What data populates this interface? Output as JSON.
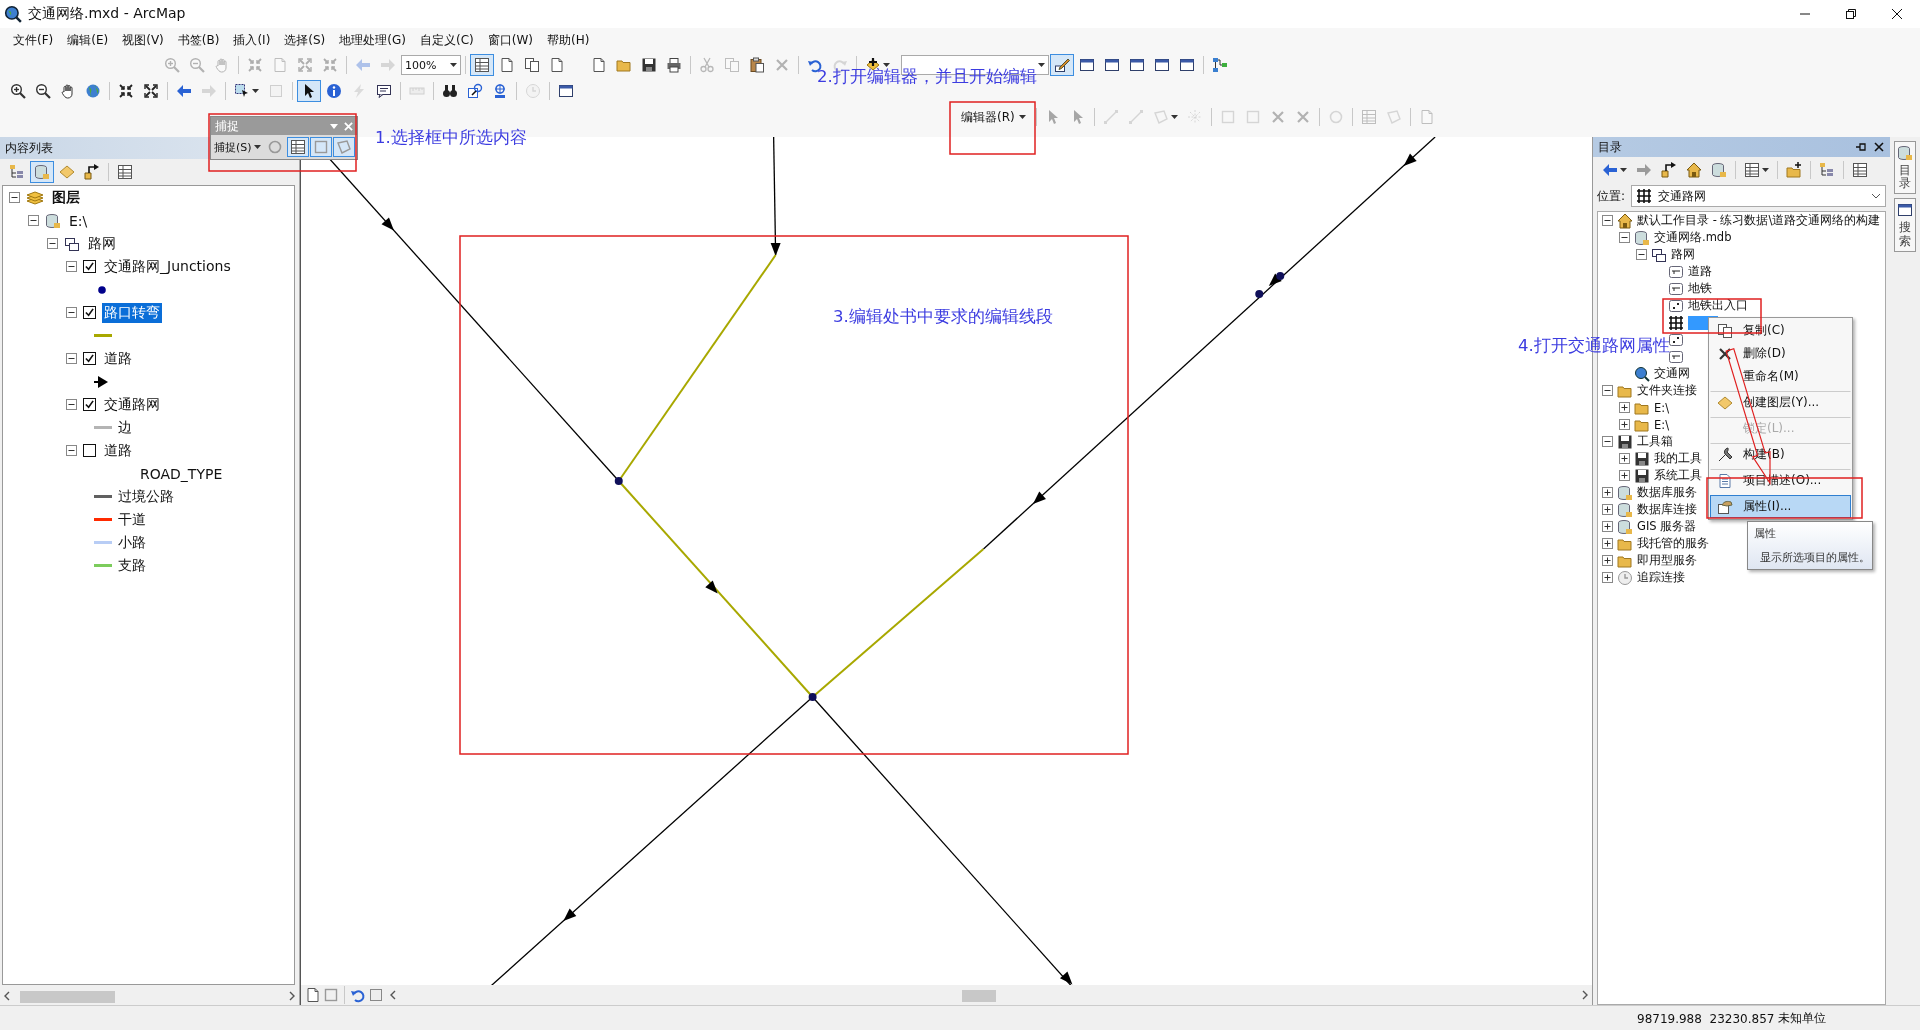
{
  "window": {
    "title": "交通网络.mxd - ArcMap"
  },
  "menu": [
    "文件(F)",
    "编辑(E)",
    "视图(V)",
    "书签(B)",
    "插入(I)",
    "选择(S)",
    "地理处理(G)",
    "自定义(C)",
    "窗口(W)",
    "帮助(H)"
  ],
  "toolbars": {
    "layout": {
      "before": [
        {
          "disabled": true,
          "pressed": false
        },
        {
          "disabled": true,
          "pressed": false
        },
        {
          "disabled": true,
          "pressed": false
        },
        {
          "disabled": true,
          "pressed": false
        },
        {
          "disabled": true,
          "pressed": false
        },
        {
          "disabled": true,
          "pressed": false
        },
        {
          "disabled": true,
          "pressed": false
        },
        {
          "disabled": true,
          "pressed": false
        },
        {
          "disabled": true,
          "pressed": false
        }
      ],
      "zoom": "100%",
      "after": [
        {
          "disabled": false,
          "pressed": true
        },
        {
          "disabled": false,
          "pressed": false
        },
        {
          "disabled": false,
          "pressed": false
        },
        {
          "disabled": false,
          "pressed": false
        }
      ]
    },
    "standard": {
      "buttons": [
        {
          "disabled": false,
          "pressed": false
        },
        {
          "disabled": false,
          "pressed": false
        },
        {
          "disabled": false,
          "pressed": false
        },
        {
          "disabled": false,
          "pressed": false
        },
        {
          "disabled": true,
          "pressed": false
        },
        {
          "disabled": true,
          "pressed": false
        },
        {
          "disabled": false,
          "pressed": false
        },
        {
          "disabled": true,
          "pressed": false
        },
        {
          "disabled": false,
          "pressed": false
        },
        {
          "disabled": true,
          "pressed": false
        },
        {
          "disabled": false,
          "pressed": false
        }
      ]
    },
    "windows": {
      "buttons": [
        {
          "disabled": false,
          "pressed": true
        },
        {
          "disabled": false,
          "pressed": false
        },
        {
          "disabled": false,
          "pressed": false
        },
        {
          "disabled": false,
          "pressed": false
        },
        {
          "disabled": false,
          "pressed": false
        },
        {
          "disabled": false,
          "pressed": false
        },
        {
          "disabled": false,
          "pressed": false
        }
      ]
    },
    "tools": {
      "buttons": [
        {
          "disabled": false,
          "pressed": false
        },
        {
          "disabled": false,
          "pressed": false
        },
        {
          "disabled": false,
          "pressed": false
        },
        {
          "disabled": false,
          "pressed": false
        },
        {
          "disabled": false,
          "pressed": false
        },
        {
          "disabled": false,
          "pressed": false
        },
        {
          "disabled": false,
          "pressed": false
        },
        {
          "disabled": true,
          "pressed": false
        },
        {
          "disabled": false,
          "pressed": false
        },
        {
          "disabled": true,
          "pressed": false
        },
        {
          "disabled": false,
          "pressed": true
        },
        {
          "disabled": false,
          "pressed": false
        },
        {
          "disabled": true,
          "pressed": false
        },
        {
          "disabled": false,
          "pressed": false
        },
        {
          "disabled": true,
          "pressed": false
        },
        {
          "disabled": false,
          "pressed": false
        },
        {
          "disabled": false,
          "pressed": false
        },
        {
          "disabled": false,
          "pressed": false
        },
        {
          "disabled": true,
          "pressed": false
        },
        {
          "disabled": false,
          "pressed": false
        }
      ]
    },
    "editor": {
      "menu": "编辑器(R)",
      "buttons": [
        {
          "disabled": true,
          "pressed": false
        },
        {
          "disabled": true,
          "pressed": false
        },
        {
          "disabled": true,
          "pressed": false
        },
        {
          "disabled": true,
          "pressed": false
        },
        {
          "disabled": true,
          "pressed": false
        },
        {
          "disabled": true,
          "pressed": false
        },
        {
          "disabled": true,
          "pressed": false
        },
        {
          "disabled": true,
          "pressed": false
        },
        {
          "disabled": true,
          "pressed": false
        },
        {
          "disabled": true,
          "pressed": false
        },
        {
          "disabled": true,
          "pressed": false
        },
        {
          "disabled": true,
          "pressed": false
        },
        {
          "disabled": true,
          "pressed": false
        },
        {
          "disabled": true,
          "pressed": false
        }
      ]
    }
  },
  "snapping": {
    "title": "捕捉",
    "menu": "捕捉(S)",
    "buttons": [
      {
        "pressed": false
      },
      {
        "pressed": true
      },
      {
        "pressed": true
      },
      {
        "pressed": true
      }
    ]
  },
  "contents": {
    "title": "内容列表",
    "view_buttons": [
      {
        "pressed": false
      },
      {
        "pressed": true
      },
      {
        "pressed": false
      },
      {
        "pressed": false
      },
      {
        "pressed": false
      }
    ],
    "tree": [
      {
        "label": "图层",
        "kind": "frame",
        "expanded": true,
        "children": [
          {
            "label": "E:\\",
            "kind": "database",
            "expanded": true,
            "children": [
              {
                "label": "路网",
                "kind": "group",
                "expanded": true,
                "children": [
                  {
                    "label": "交通路网_Junctions",
                    "kind": "layer",
                    "expanded": true,
                    "checked": true,
                    "selected": false,
                    "legend": [
                      {
                        "kind": "point",
                        "color": "#00008b"
                      }
                    ]
                  },
                  {
                    "label": "路口转弯",
                    "kind": "layer",
                    "expanded": true,
                    "checked": true,
                    "selected": true,
                    "legend": [
                      {
                        "kind": "line",
                        "color": "#a8a800"
                      }
                    ]
                  },
                  {
                    "label": "道路",
                    "kind": "layer",
                    "expanded": true,
                    "checked": true,
                    "selected": false,
                    "legend": [
                      {
                        "kind": "arrow",
                        "color": "#000000"
                      }
                    ]
                  },
                  {
                    "label": "交通路网",
                    "kind": "layer",
                    "expanded": true,
                    "checked": true,
                    "selected": false,
                    "legend": [
                      {
                        "kind": "line",
                        "color": "#b4b4b4",
                        "label": "边"
                      }
                    ]
                  },
                  {
                    "label": "道路",
                    "kind": "layer",
                    "expanded": true,
                    "checked": false,
                    "selected": false,
                    "legend": [
                      {
                        "kind": "heading",
                        "label": "ROAD_TYPE"
                      },
                      {
                        "kind": "line",
                        "color": "#606060",
                        "label": "过境公路"
                      },
                      {
                        "kind": "line",
                        "color": "#ff2a00",
                        "label": "干道"
                      },
                      {
                        "kind": "line",
                        "color": "#b8cdf5",
                        "label": "小路"
                      },
                      {
                        "kind": "line",
                        "color": "#7ccc5c",
                        "label": "支路"
                      }
                    ]
                  }
                ]
              }
            ]
          }
        ]
      }
    ]
  },
  "catalog": {
    "title": "目录",
    "location_label": "位置:",
    "location": "交通路网",
    "tree": [
      {
        "label": "默认工作目录 - 练习数据\\道路交通网络的构建",
        "kind": "home-folder",
        "expanded": true,
        "children": [
          {
            "label": "交通网络.mdb",
            "kind": "database",
            "expanded": true,
            "children": [
              {
                "label": "路网",
                "kind": "dataset",
                "expanded": true,
                "children": [
                  {
                    "label": "道路",
                    "kind": "line-class",
                    "selected": false
                  },
                  {
                    "label": "地铁",
                    "kind": "line-class",
                    "selected": false
                  },
                  {
                    "label": "地铁出入口",
                    "kind": "point-class",
                    "selected": false
                  },
                  {
                    "kind": "network",
                    "selected": true
                  },
                  {
                    "kind": "point-class",
                    "selected": false
                  },
                  {
                    "kind": "line-class",
                    "selected": false
                  }
                ]
              }
            ]
          },
          {
            "label": "交通网",
            "kind": "locator"
          }
        ]
      },
      {
        "label": "文件夹连接",
        "kind": "folder",
        "expanded": true,
        "children": [
          {
            "label": "E:\\",
            "kind": "folder",
            "expanded": false
          },
          {
            "label": "E:\\",
            "kind": "folder",
            "expanded": false
          }
        ]
      },
      {
        "label": "工具箱",
        "kind": "toolbox",
        "expanded": true,
        "children": [
          {
            "label": "我的工具",
            "kind": "toolbox",
            "expanded": false
          },
          {
            "label": "系统工具",
            "kind": "toolbox",
            "expanded": false
          }
        ]
      },
      {
        "label": "数据库服务",
        "kind": "server",
        "expanded": false
      },
      {
        "label": "数据库连接",
        "kind": "server",
        "expanded": false
      },
      {
        "label": "GIS 服务器",
        "kind": "server",
        "expanded": false
      },
      {
        "label": "我托管的服务",
        "kind": "cloud",
        "expanded": false
      },
      {
        "label": "即用型服务",
        "kind": "cloud",
        "expanded": false
      },
      {
        "label": "追踪连接",
        "kind": "tracking",
        "expanded": false
      }
    ]
  },
  "context_menu": {
    "items": [
      {
        "label": "复制(C)",
        "kind": "copy",
        "disabled": false,
        "selected": false,
        "divider_above": false
      },
      {
        "label": "删除(D)",
        "kind": "delete",
        "disabled": false,
        "selected": false,
        "divider_above": false
      },
      {
        "label": "重命名(M)",
        "kind": "plain",
        "disabled": false,
        "selected": false,
        "divider_above": false
      },
      {
        "label": "创建图层(Y)...",
        "kind": "layer",
        "disabled": false,
        "selected": false,
        "divider_above": true
      },
      {
        "label": "锁定(L)...",
        "kind": "plain",
        "disabled": true,
        "selected": false,
        "divider_above": true
      },
      {
        "label": "构建(B)",
        "kind": "build",
        "disabled": false,
        "selected": false,
        "divider_above": true
      },
      {
        "label": "项目描述(O)...",
        "kind": "document",
        "disabled": false,
        "selected": false,
        "divider_above": true
      },
      {
        "label": "属性(I)...",
        "kind": "properties",
        "disabled": false,
        "selected": true,
        "divider_above": true
      }
    ]
  },
  "tooltip": {
    "title": "属性",
    "text": "显示所选项目的属性。"
  },
  "side_tabs": [
    {
      "label": "目录"
    },
    {
      "label": "搜索"
    }
  ],
  "annotations": [
    {
      "text": "1.选择框中所选内容"
    },
    {
      "text": "2.打开编辑器，并且开始编辑"
    },
    {
      "text": "3.编辑处书中要求的编辑线段"
    },
    {
      "text": "4.打开交通路网属性"
    }
  ],
  "status_bar": {
    "coordinates": "98719.988  23230.857",
    "units": "未知单位"
  }
}
